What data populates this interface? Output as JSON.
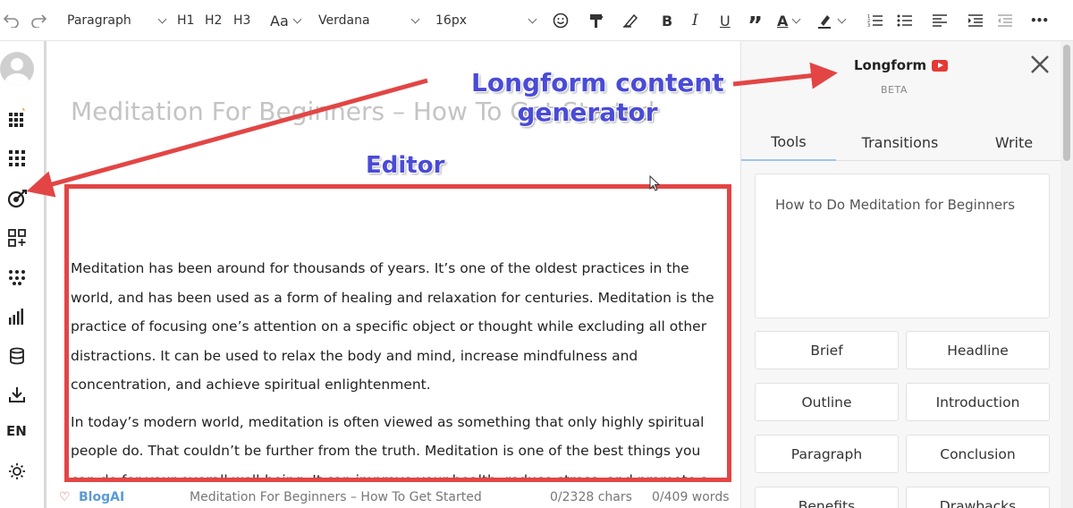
{
  "toolbar": {
    "block_format": "Paragraph",
    "h1": "H1",
    "h2": "H2",
    "h3": "H3",
    "case_label": "Aa",
    "font_family": "Verdana",
    "font_size": "16px",
    "bold": "B",
    "italic": "I",
    "underline": "U",
    "quote": "”",
    "text_color_label": "A",
    "more": "•••"
  },
  "sidebar": {
    "language": "EN"
  },
  "editor": {
    "title": "Meditation For Beginners – How To Get Started",
    "paragraphs": [
      "Meditation has been around for thousands of years. It’s one of the oldest practices in the world, and has been used as a form of healing and relaxation for centuries. Meditation is the practice of focusing one’s attention on a specific object or thought while excluding all other distractions. It can be used to relax the body and mind, increase mindfulness and concentration, and achieve spiritual enlightenment.",
      "In today’s modern world, meditation is often viewed as something that only highly spiritual people do. That couldn’t be further from the truth. Meditation is one of the best things you can do for your overall well-being. It can improve your health, reduce stress, and promote a sense of calm."
    ]
  },
  "statusbar": {
    "brand": "BlogAI",
    "doc_title": "Meditation For Beginners – How To Get Started",
    "chars": "0/2328  chars",
    "words": "0/409 words"
  },
  "panel": {
    "title": "Longform",
    "subtitle": "BETA",
    "tabs": [
      "Tools",
      "Transitions",
      "Write"
    ],
    "prompt_value": "How to  Do Meditation for Beginners",
    "buttons": [
      "Brief",
      "Headline",
      "Outline",
      "Introduction",
      "Paragraph",
      "Conclusion",
      "Benefits",
      "Drawbacks"
    ]
  },
  "annotations": {
    "longform_line1": "Longform content",
    "longform_line2": "generator",
    "editor_label": "Editor"
  },
  "colors": {
    "annotation_text": "#4a4bd6",
    "annotation_arrow": "#e34545",
    "brand": "#5b9bd5",
    "youtube_red": "#e53935"
  }
}
